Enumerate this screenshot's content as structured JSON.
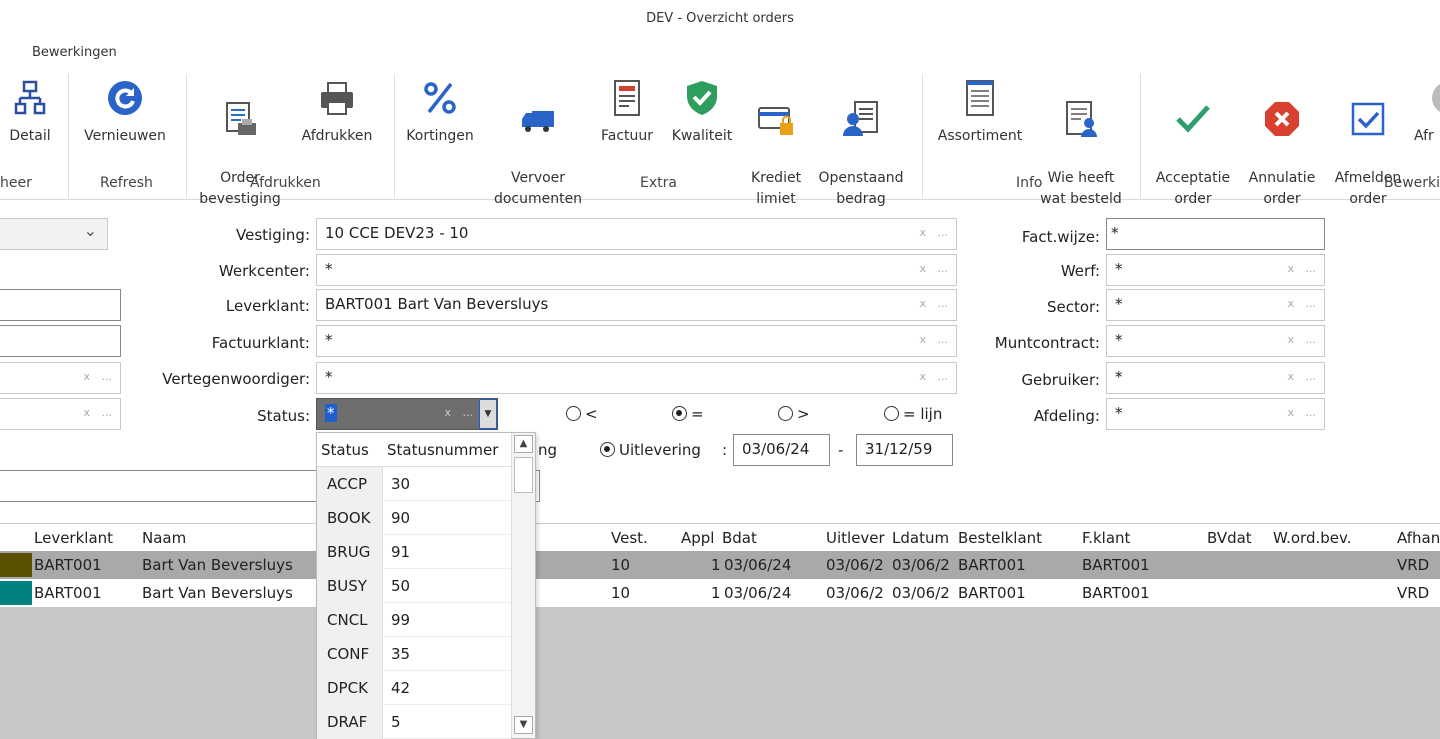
{
  "window": {
    "title": "DEV - Overzicht orders"
  },
  "ribbon_tab": "Bewerkingen",
  "ribbon": {
    "buttons": [
      {
        "label": "Detail",
        "icon": "hierarchy-icon"
      },
      {
        "label": "Vernieuwen",
        "icon": "refresh-icon"
      },
      {
        "label": "Order\nbevestiging",
        "icon": "order-confirm-icon"
      },
      {
        "label": "Afdrukken",
        "icon": "printer-icon"
      },
      {
        "label": "Kortingen",
        "icon": "percent-icon"
      },
      {
        "label": "Vervoer\ndocumenten",
        "icon": "truck-icon"
      },
      {
        "label": "Factuur",
        "icon": "invoice-icon"
      },
      {
        "label": "Kwaliteit",
        "icon": "shield-check-icon"
      },
      {
        "label": "Krediet\nlimiet",
        "icon": "credit-card-lock-icon"
      },
      {
        "label": "Openstaand\nbedrag",
        "icon": "user-document-icon"
      },
      {
        "label": "Assortiment",
        "icon": "list-document-icon"
      },
      {
        "label": "Wie heeft\nwat besteld",
        "icon": "user-list-icon"
      },
      {
        "label": "Acceptatie\norder",
        "icon": "checkmark-icon"
      },
      {
        "label": "Annulatie\norder",
        "icon": "cancel-icon"
      },
      {
        "label": "Afmelden\norder",
        "icon": "checkbox-icon"
      },
      {
        "label": "Afr",
        "icon": "partial-icon"
      }
    ],
    "groups": [
      "heer",
      "Refresh",
      "Afdrukken",
      "Extra",
      "Info",
      "Bewerki"
    ]
  },
  "form": {
    "vestiging": {
      "label": "Vestiging:",
      "value": "10 CCE DEV23 - 10"
    },
    "werkcenter": {
      "label": "Werkcenter:",
      "value": "*"
    },
    "leverklant": {
      "label": "Leverklant:",
      "value": "BART001 Bart Van Beversluys"
    },
    "factuurklant": {
      "label": "Factuurklant:",
      "value": "*"
    },
    "vertegenwoordiger": {
      "label": "Vertegenwoordiger:",
      "value": "*"
    },
    "status": {
      "label": "Status:",
      "value": "*"
    },
    "factwijze": {
      "label": "Fact.wijze:",
      "value": "*"
    },
    "werf": {
      "label": "Werf:",
      "value": "*"
    },
    "sector": {
      "label": "Sector:",
      "value": "*"
    },
    "muntcontract": {
      "label": "Muntcontract:",
      "value": "*"
    },
    "gebruiker": {
      "label": "Gebruiker:",
      "value": "*"
    },
    "afdeling": {
      "label": "Afdeling:",
      "value": "*"
    },
    "radios": [
      "<",
      "=",
      ">",
      "= lijn"
    ],
    "radio_selected": "=",
    "date_type_partial": "ng",
    "date_type": "Uitlevering",
    "date_from": "03/06/24",
    "date_to": "31/12/59",
    "date_colon": ":",
    "date_dash": "-"
  },
  "clear_glyph": "x",
  "dots_glyph": "...",
  "dropdown": {
    "headers": [
      "Status",
      "Statusnummer"
    ],
    "rows": [
      [
        "ACCP",
        "30"
      ],
      [
        "BOOK",
        "90"
      ],
      [
        "BRUG",
        "91"
      ],
      [
        "BUSY",
        "50"
      ],
      [
        "CNCL",
        "99"
      ],
      [
        "CONF",
        "35"
      ],
      [
        "DPCK",
        "42"
      ],
      [
        "DRAF",
        "5"
      ]
    ]
  },
  "grid": {
    "headers": [
      "Leverklant",
      "Naam",
      "Vest.",
      "Appl",
      "Bdat",
      "Uitlever",
      "Ldatum",
      "Bestelklant",
      "F.klant",
      "BVdat",
      "W.ord.bev.",
      "Afhan"
    ],
    "rows": [
      {
        "leverklant": "BART001",
        "naam": "Bart Van Beversluys",
        "vest": "10",
        "appl": "1",
        "bdat": "03/06/24",
        "uitlever": "03/06/2",
        "ldatum": "03/06/2",
        "bestelklant": "BART001",
        "fklant": "BART001",
        "afhan": "VRD",
        "marker": "#5a5200"
      },
      {
        "leverklant": "BART001",
        "naam": "Bart Van Beversluys",
        "vest": "10",
        "appl": "1",
        "bdat": "03/06/24",
        "uitlever": "03/06/2",
        "ldatum": "03/06/2",
        "bestelklant": "BART001",
        "fklant": "BART001",
        "afhan": "VRD",
        "marker": "#008080"
      }
    ]
  }
}
